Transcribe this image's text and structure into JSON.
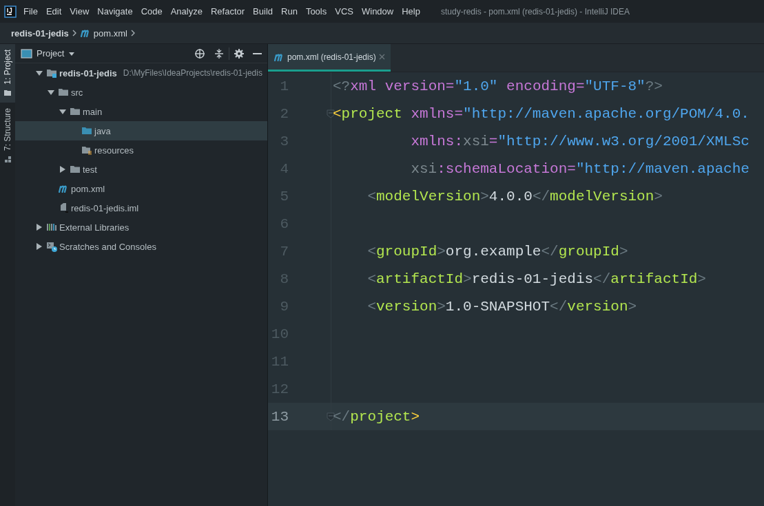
{
  "window": {
    "title": "study-redis - pom.xml (redis-01-jedis) - IntelliJ IDEA"
  },
  "menu": [
    "File",
    "Edit",
    "View",
    "Navigate",
    "Code",
    "Analyze",
    "Refactor",
    "Build",
    "Run",
    "Tools",
    "VCS",
    "Window",
    "Help"
  ],
  "breadcrumbs": [
    {
      "label": "redis-01-jedis",
      "kind": "module"
    },
    {
      "label": "pom.xml",
      "kind": "maven"
    }
  ],
  "tool_strip": [
    {
      "label": "1: Project",
      "kind": "folder",
      "selected": true
    },
    {
      "label": "7: Structure",
      "kind": "structure",
      "selected": false
    }
  ],
  "project_panel": {
    "title": "Project",
    "tree": [
      {
        "name": "redis-01-jedis",
        "kind": "module",
        "path": "D:\\MyFiles\\IdeaProjects\\redis-01-jedis",
        "expanded": true,
        "selected": false,
        "children": [
          {
            "name": "src",
            "kind": "folder",
            "expanded": true,
            "selected": false,
            "children": [
              {
                "name": "main",
                "kind": "folder",
                "expanded": true,
                "selected": false,
                "children": [
                  {
                    "name": "java",
                    "kind": "source-folder",
                    "selected": true
                  },
                  {
                    "name": "resources",
                    "kind": "resource-folder",
                    "selected": false
                  }
                ]
              },
              {
                "name": "test",
                "kind": "folder",
                "expanded": false,
                "selected": false
              }
            ]
          },
          {
            "name": "pom.xml",
            "kind": "maven",
            "selected": false
          },
          {
            "name": "redis-01-jedis.iml",
            "kind": "iml",
            "selected": false
          }
        ]
      },
      {
        "name": "External Libraries",
        "kind": "libraries",
        "expanded": false,
        "selected": false
      },
      {
        "name": "Scratches and Consoles",
        "kind": "scratches",
        "expanded": false,
        "selected": false
      }
    ]
  },
  "editor": {
    "tabs": [
      {
        "label": "pom.xml (redis-01-jedis)",
        "kind": "maven",
        "selected": true
      }
    ],
    "lines": [
      {
        "number": "1",
        "fold": false,
        "current": false,
        "tokens": [
          {
            "kind": "bracket",
            "text": "<?"
          },
          {
            "kind": "attr",
            "text": "xml version="
          },
          {
            "kind": "value",
            "text": "\"1.0\""
          },
          {
            "kind": "attr",
            "text": " encoding="
          },
          {
            "kind": "value",
            "text": "\"UTF-8\""
          },
          {
            "kind": "bracket",
            "text": "?>"
          }
        ]
      },
      {
        "number": "2",
        "fold": true,
        "current": false,
        "tokens": [
          {
            "kind": "match",
            "text": "<"
          },
          {
            "kind": "tag",
            "text": "project"
          },
          {
            "kind": "attr",
            "text": " xmlns="
          },
          {
            "kind": "value",
            "text": "\"http://maven.apache.org/POM/4.0."
          }
        ]
      },
      {
        "number": "3",
        "fold": false,
        "current": false,
        "tokens": [
          {
            "kind": "attr",
            "text": "         xmlns:"
          },
          {
            "kind": "ns",
            "text": "xsi"
          },
          {
            "kind": "attr",
            "text": "="
          },
          {
            "kind": "value",
            "text": "\"http://www.w3.org/2001/XMLSc"
          }
        ]
      },
      {
        "number": "4",
        "fold": false,
        "current": false,
        "tokens": [
          {
            "kind": "ns",
            "text": "         xsi"
          },
          {
            "kind": "attr",
            "text": ":schemaLocation="
          },
          {
            "kind": "value",
            "text": "\"http://maven.apache"
          }
        ]
      },
      {
        "number": "5",
        "fold": false,
        "current": false,
        "tokens": [
          {
            "kind": "bracket",
            "text": "    <"
          },
          {
            "kind": "tag",
            "text": "modelVersion"
          },
          {
            "kind": "bracket",
            "text": ">"
          },
          {
            "kind": "text",
            "text": "4.0.0"
          },
          {
            "kind": "bracket",
            "text": "</"
          },
          {
            "kind": "tag",
            "text": "modelVersion"
          },
          {
            "kind": "bracket",
            "text": ">"
          }
        ]
      },
      {
        "number": "6",
        "fold": false,
        "current": false
      },
      {
        "number": "7",
        "fold": false,
        "current": false,
        "tokens": [
          {
            "kind": "bracket",
            "text": "    <"
          },
          {
            "kind": "tag",
            "text": "groupId"
          },
          {
            "kind": "bracket",
            "text": ">"
          },
          {
            "kind": "text",
            "text": "org.example"
          },
          {
            "kind": "bracket",
            "text": "</"
          },
          {
            "kind": "tag",
            "text": "groupId"
          },
          {
            "kind": "bracket",
            "text": ">"
          }
        ]
      },
      {
        "number": "8",
        "fold": false,
        "current": false,
        "tokens": [
          {
            "kind": "bracket",
            "text": "    <"
          },
          {
            "kind": "tag",
            "text": "artifactId"
          },
          {
            "kind": "bracket",
            "text": ">"
          },
          {
            "kind": "text",
            "text": "redis-01-jedis"
          },
          {
            "kind": "bracket",
            "text": "</"
          },
          {
            "kind": "tag",
            "text": "artifactId"
          },
          {
            "kind": "bracket",
            "text": ">"
          }
        ]
      },
      {
        "number": "9",
        "fold": false,
        "current": false,
        "tokens": [
          {
            "kind": "bracket",
            "text": "    <"
          },
          {
            "kind": "tag",
            "text": "version"
          },
          {
            "kind": "bracket",
            "text": ">"
          },
          {
            "kind": "text",
            "text": "1.0-SNAPSHOT"
          },
          {
            "kind": "bracket",
            "text": "</"
          },
          {
            "kind": "tag",
            "text": "version"
          },
          {
            "kind": "bracket",
            "text": ">"
          }
        ]
      },
      {
        "number": "10",
        "fold": false,
        "current": false
      },
      {
        "number": "11",
        "fold": false,
        "current": false
      },
      {
        "number": "12",
        "fold": false,
        "current": false
      },
      {
        "number": "13",
        "fold": true,
        "current": true,
        "tokens": [
          {
            "kind": "bracket",
            "text": "</"
          },
          {
            "kind": "tag",
            "text": "project"
          },
          {
            "kind": "match",
            "text": ">"
          }
        ]
      }
    ]
  }
}
